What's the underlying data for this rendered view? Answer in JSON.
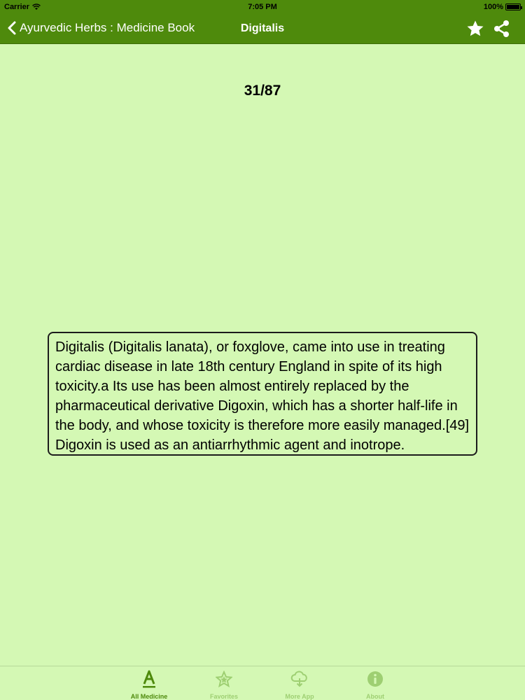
{
  "status_bar": {
    "carrier": "Carrier",
    "time": "7:05 PM",
    "battery": "100%"
  },
  "nav": {
    "back_label": "Ayurvedic Herbs : Medicine Book",
    "title": "Digitalis",
    "favorite_icon": "star-icon",
    "share_icon": "share-icon"
  },
  "page": {
    "counter": "31/87"
  },
  "content": {
    "text": "Digitalis (Digitalis lanata), or foxglove, came into use in treating cardiac disease in late 18th century England in spite of its high toxicity.a Its use has been almost entirely replaced by the pharmaceutical derivative Digoxin, which has a shorter half-life in the body, and whose toxicity is therefore more easily managed.[49] Digoxin is used as an antiarrhythmic agent and inotrope."
  },
  "tabs": [
    {
      "label": "All Medicine",
      "icon": "letter-a-icon",
      "active": true
    },
    {
      "label": "Favorites",
      "icon": "star-outline-icon",
      "active": false
    },
    {
      "label": "More App",
      "icon": "cloud-download-icon",
      "active": false
    },
    {
      "label": "About",
      "icon": "info-icon",
      "active": false
    }
  ],
  "colors": {
    "accent": "#4e8a0c",
    "background": "#d4f8b4",
    "tab_active": "#4e8a0c",
    "tab_inactive": "#9ecf72"
  }
}
